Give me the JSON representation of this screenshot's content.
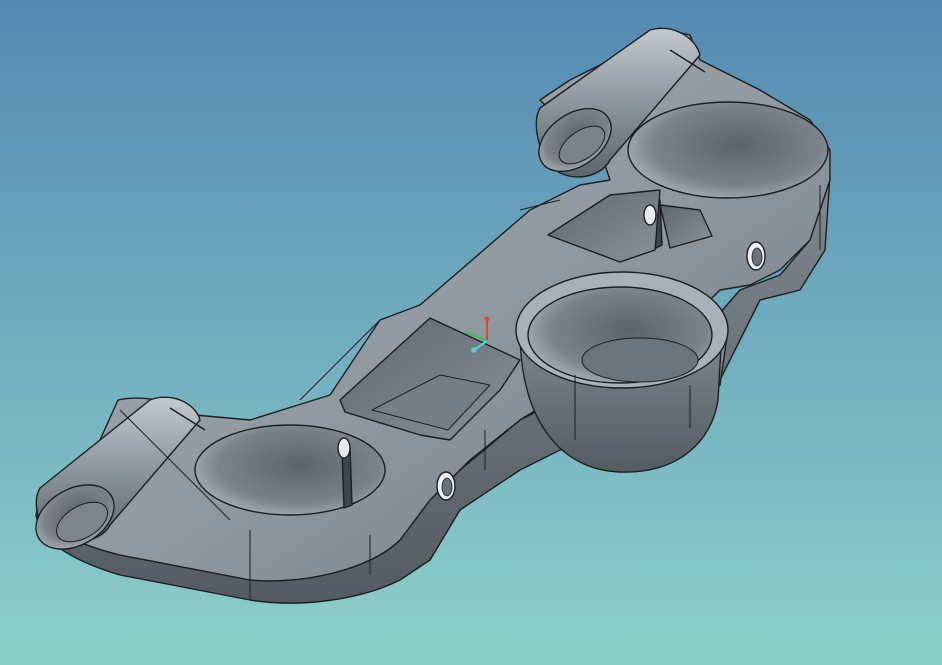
{
  "viewport": {
    "background_top_color": "#5489b3",
    "background_bottom_color": "#8dd0c9"
  },
  "model": {
    "name": "triple-clamp",
    "body_color": "#8f979f",
    "face_light_color": "#b3bac1",
    "face_dark_color": "#5e666e",
    "edge_color": "#1c1f22"
  },
  "triad": {
    "x_axis_color": "#e0453a",
    "y_axis_color": "#3bc24a",
    "z_axis_color": "#4ed2e0"
  }
}
